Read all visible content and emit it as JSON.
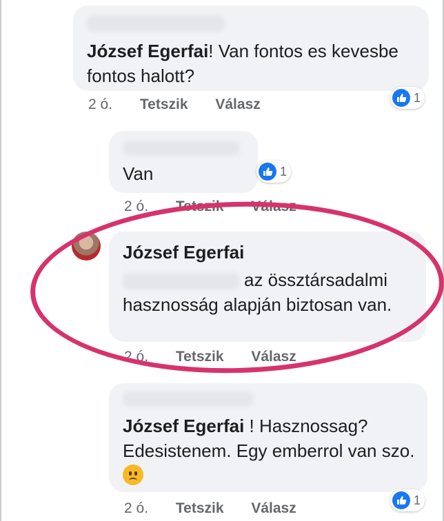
{
  "comments": [
    {
      "author": "József Egerfai",
      "text_after": "! Van fontos es kevesbe fontos halott?",
      "time": "2 ó.",
      "like_label": "Tetszik",
      "reply_label": "Válasz",
      "reactions": "1"
    },
    {
      "text": "Van",
      "time": "2 ó.",
      "like_label": "Tetszik",
      "reply_label": "Válasz",
      "reactions": "1"
    },
    {
      "author": "József Egerfai",
      "text_after": "az össztársadalmi hasznosság alapján biztosan van.",
      "time": "2 ó.",
      "like_label": "Tetszik",
      "reply_label": "Válasz"
    },
    {
      "author": "József Egerfai",
      "text_after": " ! Hasznossag? Edesistenem. Egy emberrol van szo.",
      "time": "2 ó.",
      "like_label": "Tetszik",
      "reply_label": "Válasz",
      "reactions": "1"
    }
  ],
  "colors": {
    "bubble": "#f0f2f5",
    "like_blue": "#1877f2",
    "highlight": "#d6336c",
    "meta_gray": "#65676b"
  },
  "icons": {
    "like": "thumbs-up-icon",
    "sad": "sad-face-emoji"
  }
}
